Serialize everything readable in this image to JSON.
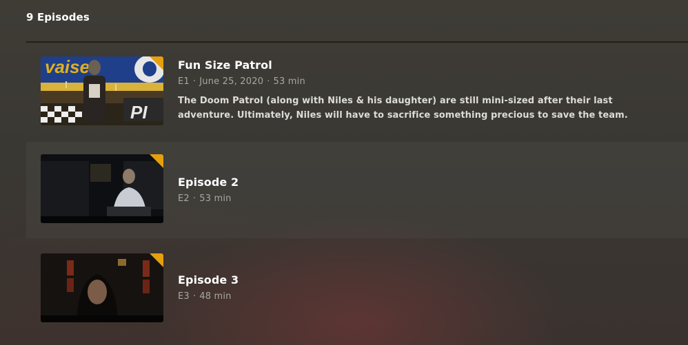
{
  "header": {
    "episode_count": "9 Episodes"
  },
  "accent_color": "#e5a00d",
  "episodes": [
    {
      "title": "Fun Size Patrol",
      "number": "E1",
      "date": "June 25, 2020",
      "duration": "53 min",
      "summary": "The Doom Patrol (along with Niles & his daughter) are still mini-sized after their last adventure. Ultimately, Niles will have to sacrifice something precious to save the team."
    },
    {
      "title": "Episode 2",
      "number": "E2",
      "duration": "53 min"
    },
    {
      "title": "Episode 3",
      "number": "E3",
      "duration": "48 min"
    }
  ]
}
